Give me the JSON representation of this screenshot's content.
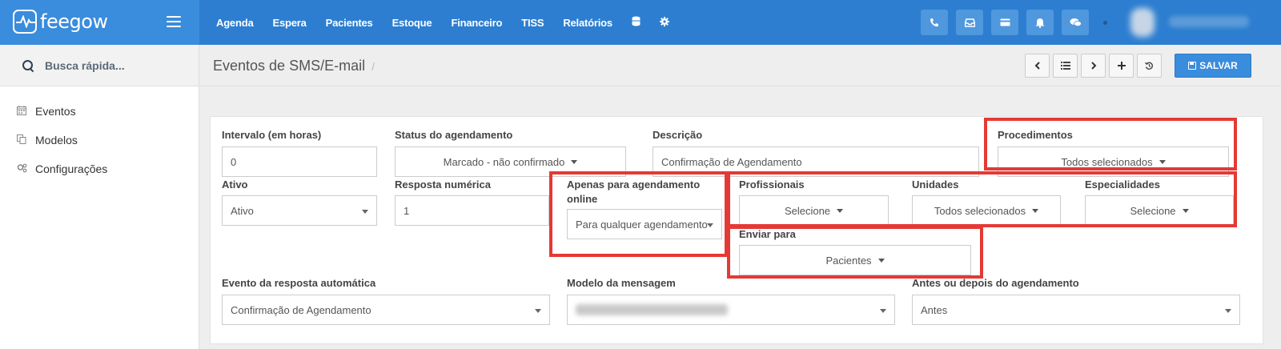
{
  "app": {
    "brand": "feegow"
  },
  "topnav": {
    "items": [
      "Agenda",
      "Espera",
      "Pacientes",
      "Estoque",
      "Financeiro",
      "TISS",
      "Relatórios"
    ],
    "icons": [
      "database-icon",
      "gear-icon"
    ],
    "right_icons": [
      "phone-icon",
      "inbox-icon",
      "card-icon",
      "bell-icon",
      "chat-icon"
    ]
  },
  "sidebar": {
    "search_placeholder": "Busca rápida...",
    "items": [
      {
        "label": "Eventos",
        "icon": "calendar-icon"
      },
      {
        "label": "Modelos",
        "icon": "copy-icon"
      },
      {
        "label": "Configurações",
        "icon": "cogs-icon"
      }
    ]
  },
  "header": {
    "title": "Eventos de SMS/E-mail",
    "separator": "/",
    "save_label": "SALVAR",
    "toolbar_icons": [
      "chevron-left-icon",
      "list-icon",
      "chevron-right-icon",
      "plus-icon",
      "history-icon"
    ]
  },
  "form": {
    "intervalo": {
      "label": "Intervalo (em horas)",
      "value": "0"
    },
    "status": {
      "label": "Status do agendamento",
      "value": "Marcado - não confirmado"
    },
    "descricao": {
      "label": "Descrição",
      "value": "Confirmação de Agendamento"
    },
    "procedimentos": {
      "label": "Procedimentos",
      "value": "Todos selecionados"
    },
    "ativo": {
      "label": "Ativo",
      "value": "Ativo"
    },
    "resposta": {
      "label": "Resposta numérica",
      "value": "1"
    },
    "apenas": {
      "label_line1": "Apenas para agendamento",
      "label_line2": "online",
      "value": "Para qualquer agendamento"
    },
    "profissionais": {
      "label": "Profissionais",
      "value": "Selecione"
    },
    "unidades": {
      "label": "Unidades",
      "value": "Todos selecionados"
    },
    "especialidades": {
      "label": "Especialidades",
      "value": "Selecione"
    },
    "enviar": {
      "label": "Enviar para",
      "value": "Pacientes"
    },
    "evento_resposta": {
      "label": "Evento da resposta automática",
      "value": "Confirmação de Agendamento"
    },
    "modelo": {
      "label": "Modelo da mensagem"
    },
    "antes_depois": {
      "label": "Antes ou depois do agendamento",
      "value": "Antes"
    }
  },
  "colors": {
    "topbar": "#2d7ed0",
    "accent": "#3a8cdc",
    "highlight": "#e53935"
  }
}
